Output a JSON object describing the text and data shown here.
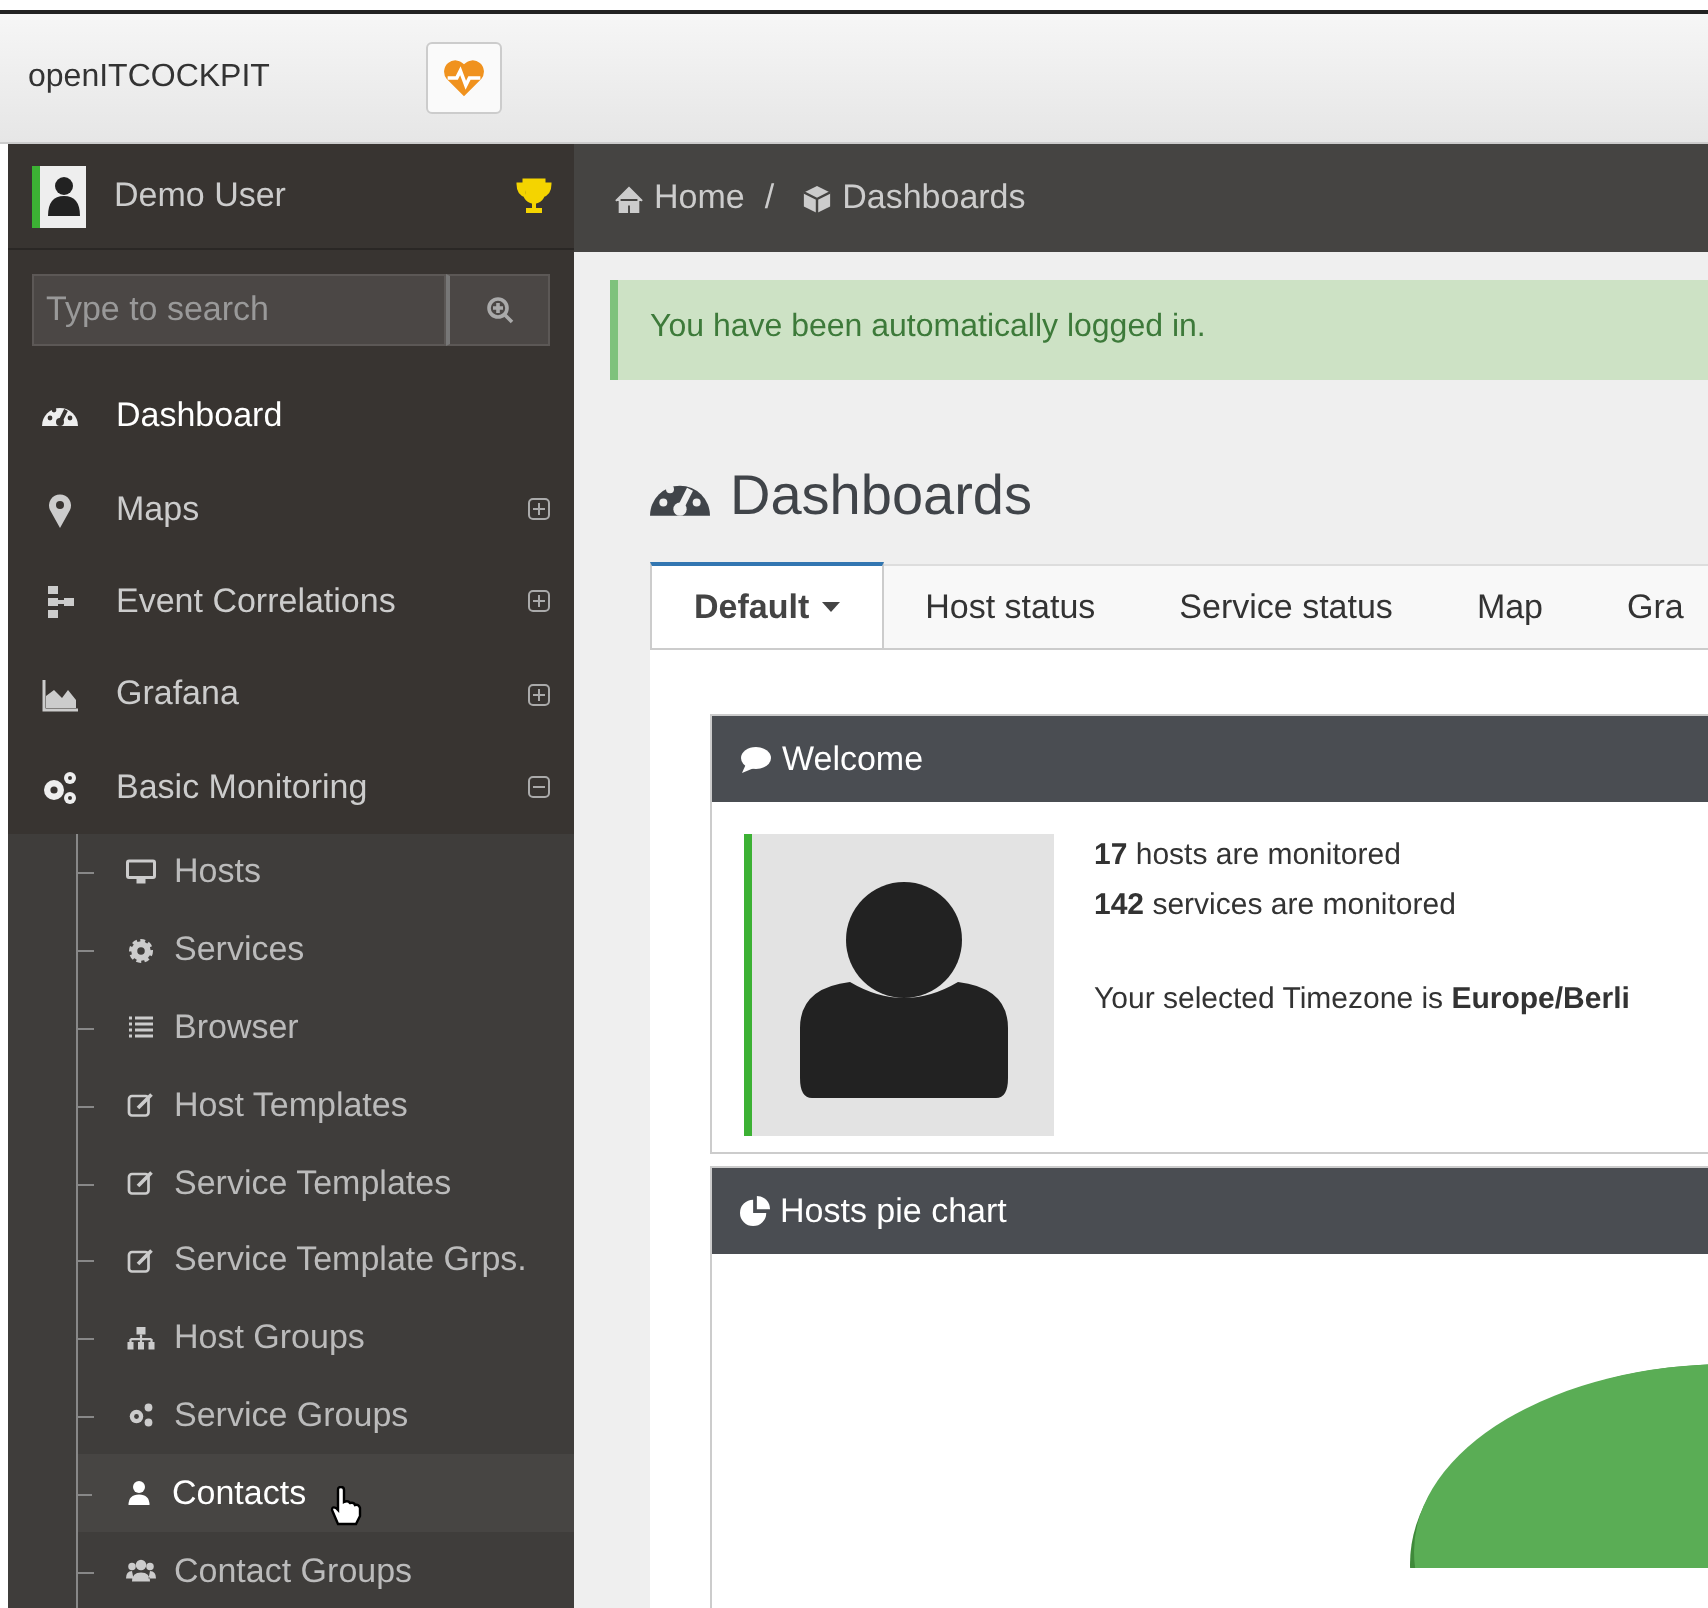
{
  "header": {
    "brand": "openITCOCKPIT"
  },
  "sidebar": {
    "user": {
      "name": "Demo User"
    },
    "search": {
      "placeholder": "Type to search"
    },
    "items": [
      {
        "label": "Dashboard",
        "kind": "link"
      },
      {
        "label": "Maps",
        "kind": "group",
        "expanded": false
      },
      {
        "label": "Event Correlations",
        "kind": "group",
        "expanded": false
      },
      {
        "label": "Grafana",
        "kind": "group",
        "expanded": false
      },
      {
        "label": "Basic Monitoring",
        "kind": "group",
        "expanded": true,
        "children": [
          {
            "label": "Hosts",
            "selected": false
          },
          {
            "label": "Services",
            "selected": false
          },
          {
            "label": "Browser",
            "selected": false
          },
          {
            "label": "Host Templates",
            "selected": false
          },
          {
            "label": "Service Templates",
            "selected": false
          },
          {
            "label": "Service Template Grps.",
            "selected": false
          },
          {
            "label": "Host Groups",
            "selected": false
          },
          {
            "label": "Service Groups",
            "selected": false
          },
          {
            "label": "Contacts",
            "selected": true
          },
          {
            "label": "Contact Groups",
            "selected": false
          }
        ]
      }
    ]
  },
  "breadcrumb": [
    {
      "label": "Home"
    },
    {
      "label": "Dashboards"
    }
  ],
  "breadcrumb_separator": "/",
  "alert": {
    "text": "You have been automatically logged in."
  },
  "page_title": "Dashboards",
  "tabs": [
    {
      "label": "Default",
      "selected": true,
      "dropdown": true
    },
    {
      "label": "Host status",
      "selected": false,
      "dropdown": false
    },
    {
      "label": "Service status",
      "selected": false,
      "dropdown": false
    },
    {
      "label": "Map",
      "selected": false,
      "dropdown": false
    },
    {
      "label": "Gra",
      "selected": false,
      "dropdown": false
    }
  ],
  "widgets": [
    {
      "kind": "welcome",
      "title": "Welcome",
      "lines": [
        "**17** hosts are monitored",
        "**142** services are monitored"
      ],
      "timezone": "Your selected Timezone is **Europe/Berli**"
    },
    {
      "kind": "pie",
      "title": "Hosts pie chart"
    }
  ]
}
